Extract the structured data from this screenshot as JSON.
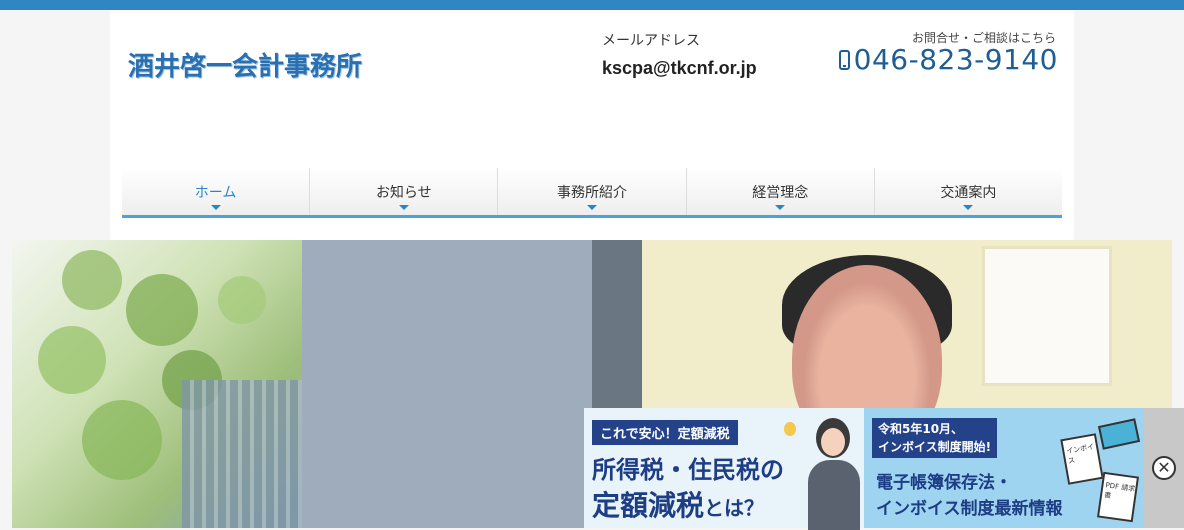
{
  "header": {
    "logo": "酒井啓一会計事務所",
    "email_label": "メールアドレス",
    "email": "kscpa@tkcnf.or.jp",
    "contact_label": "お問合せ・ご相談はこちら",
    "phone": "046-823-9140"
  },
  "nav": {
    "items": [
      {
        "label": "ホーム"
      },
      {
        "label": "お知らせ"
      },
      {
        "label": "事務所紹介"
      },
      {
        "label": "経営理念"
      },
      {
        "label": "交通案内"
      }
    ]
  },
  "banner": {
    "tag": "これで安心！定額減税",
    "line1": "所得税・住民税の",
    "line2_main": "定額減税",
    "line2_suffix": "とは？",
    "tag2_line1": "令和5年10月、",
    "tag2_line2": "インボイス制度開始!",
    "b_line1": "電子帳簿保存法・",
    "b_line2": "インボイス制度最新情報",
    "doc_label1": "インボイス",
    "doc_label2": "PDF 請求書",
    "close_symbol": "✕"
  },
  "colors": {
    "topbar": "#2f86c2",
    "accent": "#2a85c7",
    "banner_navy": "#1d3d85"
  }
}
